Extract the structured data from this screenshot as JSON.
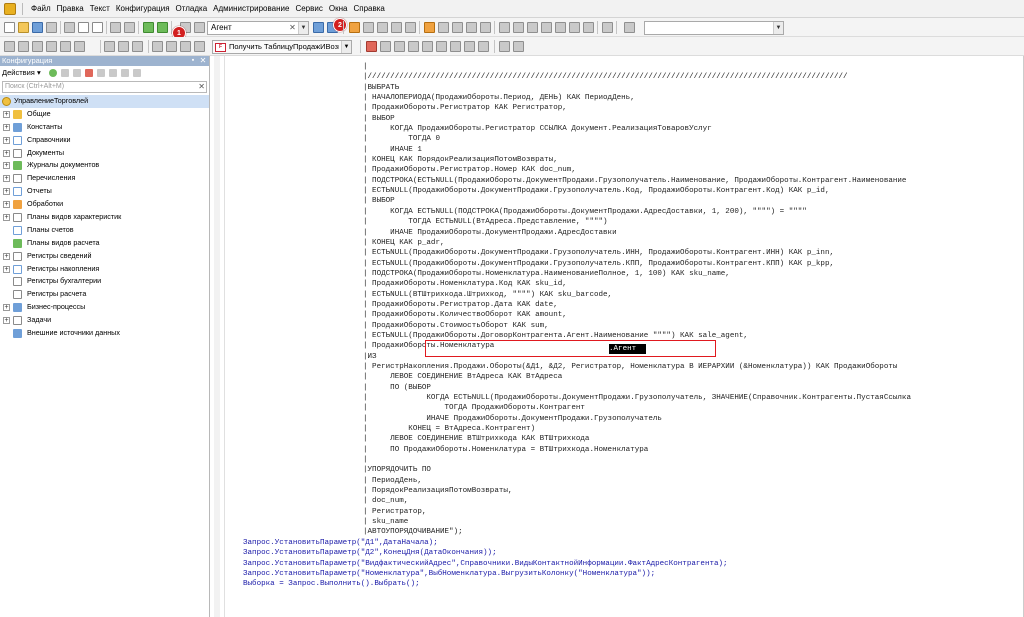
{
  "menu": {
    "items": [
      "Файл",
      "Правка",
      "Текст",
      "Конфигурация",
      "Отладка",
      "Администрирование",
      "Сервис",
      "Окна",
      "Справка"
    ]
  },
  "toolbar": {
    "search_value": "Агент",
    "badge1": "1",
    "badge2": "2",
    "query_button_label": "Получить ТаблицуПродажИВозвр"
  },
  "panel": {
    "title": "Конфигурация",
    "actions_label": "Действия ▾",
    "search_placeholder": "Поиск (Ctrl+Alt+M)",
    "root": "УправлениеТорговлей",
    "tree": [
      "Общие",
      "Константы",
      "Справочники",
      "Документы",
      "Журналы документов",
      "Перечисления",
      "Отчеты",
      "Обработки",
      "Планы видов характеристик",
      "Планы счетов",
      "Планы видов расчета",
      "Регистры сведений",
      "Регистры накопления",
      "Регистры бухгалтерии",
      "Регистры расчета",
      "Бизнес-процессы",
      "Задачи",
      "Внешние источники данных"
    ]
  },
  "editor": {
    "query_lines": [
      "|",
      "|//////////////////////////////////////////////////////////////////////////////////////////////////////////",
      "|ВЫБРАТЬ",
      "| НАЧАЛОПЕРИОДА(ПродажиОбороты.Период, ДЕНЬ) КАК ПериодДень,",
      "| ПродажиОбороты.Регистратор КАК Регистратор,",
      "| ВЫБОР",
      "|     КОГДА ПродажиОбороты.Регистратор ССЫЛКА Документ.РеализацияТоваровУслуг",
      "|         ТОГДА 0",
      "|     ИНАЧЕ 1",
      "| КОНЕЦ КАК ПорядокРеализацияПотомВозвраты,",
      "| ПродажиОбороты.Регистратор.Номер КАК doc_num,",
      "| ПОДСТРОКА(ЕСТЬNULL(ПродажиОбороты.ДокументПродажи.Грузополучатель.Наименование, ПродажиОбороты.Контрагент.Наименование",
      "| ЕСТЬNULL(ПродажиОбороты.ДокументПродажи.Грузополучатель.Код, ПродажиОбороты.Контрагент.Код) КАК p_id,",
      "| ВЫБОР",
      "|     КОГДА ЕСТЬNULL(ПОДСТРОКА(ПродажиОбороты.ДокументПродажи.АдресДоставки, 1, 200), \"\"\"\") = \"\"\"\"",
      "|         ТОГДА ЕСТЬNULL(ВтАдреса.Представление, \"\"\"\")",
      "|     ИНАЧЕ ПродажиОбороты.ДокументПродажи.АдресДоставки",
      "| КОНЕЦ КАК p_adr,",
      "| ЕСТЬNULL(ПродажиОбороты.ДокументПродажи.Грузополучатель.ИНН, ПродажиОбороты.Контрагент.ИНН) КАК p_inn,",
      "| ЕСТЬNULL(ПродажиОбороты.ДокументПродажи.Грузополучатель.КПП, ПродажиОбороты.Контрагент.КПП) КАК p_kpp,",
      "| ПОДСТРОКА(ПродажиОбороты.Номенклатура.НаименованиеПолное, 1, 100) КАК sku_name,",
      "| ПродажиОбороты.Номенклатура.Код КАК sku_id,",
      "| ЕСТЬNULL(ВТШтрихкода.Штрихкод, \"\"\"\") КАК sku_barcode,",
      "| ПродажиОбороты.Регистратор.Дата КАК date,",
      "| ПродажиОбороты.КоличествоОборот КАК amount,",
      "| ПродажиОбороты.СтоимостьОборот КАК sum,",
      "| ЕСТЬNULL(ПродажиОбороты.ДоговорКонтрагента.Агент.Наименование \"\"\"\") КАК sale_agent,",
      "| ПродажиОбороты.Номенклатура",
      "|ИЗ",
      "| РегистрНакопления.Продажи.Обороты(&Д1, &Д2, Регистратор, Номенклатура В ИЕРАРХИИ (&Номенклатура)) КАК ПродажиОбороты",
      "|     ЛЕВОЕ СОЕДИНЕНИЕ ВтАдреса КАК ВтАдреса",
      "|     ПО (ВЫБОР",
      "|             КОГДА ЕСТЬNULL(ПродажиОбороты.ДокументПродажи.Грузополучатель, ЗНАЧЕНИЕ(Справочник.Контрагенты.ПустаяСсылка",
      "|                 ТОГДА ПродажиОбороты.Контрагент",
      "|             ИНАЧЕ ПродажиОбороты.ДокументПродажи.Грузополучатель",
      "|         КОНЕЦ = ВтАдреса.Контрагент)",
      "|     ЛЕВОЕ СОЕДИНЕНИЕ ВТШтрихкода КАК ВТШтрихкода",
      "|     ПО ПродажиОбороты.Номенклатура = ВТШтрихкода.Номенклатура",
      "|",
      "|УПОРЯДОЧИТЬ ПО",
      "| ПериодДень,",
      "| ПорядокРеализацияПотомВозвраты,",
      "| doc_num,",
      "| Регистратор,",
      "| sku_name",
      "|АВТОУПОРЯДОЧИВАНИЕ\");"
    ],
    "bsl_lines": [
      "Запрос.УстановитьПараметр(\"Д1\",ДатаНачала);",
      "Запрос.УстановитьПараметр(\"Д2\",КонецДня(ДатаОкончания));",
      "Запрос.УстановитьПараметр(\"ВидфактическийАдрес\",Справочники.ВидыКонтактнойИнформации.ФактАдресКонтрагента);",
      "Запрос.УстановитьПараметр(\"Номенклатура\",ВыбНоменклатура.ВыгрузитьКолонку(\"Номенклатура\"));",
      "Выборка = Запрос.Выполнить().Выбрать();"
    ],
    "highlighted_word": ".Агент"
  },
  "colors": {
    "highlight_border": "#e0191f",
    "badge": "#d21f1f",
    "panel_title": "#9db3cf",
    "tree_selection": "#cfe0f5",
    "code_blue": "#1a1aa8"
  }
}
